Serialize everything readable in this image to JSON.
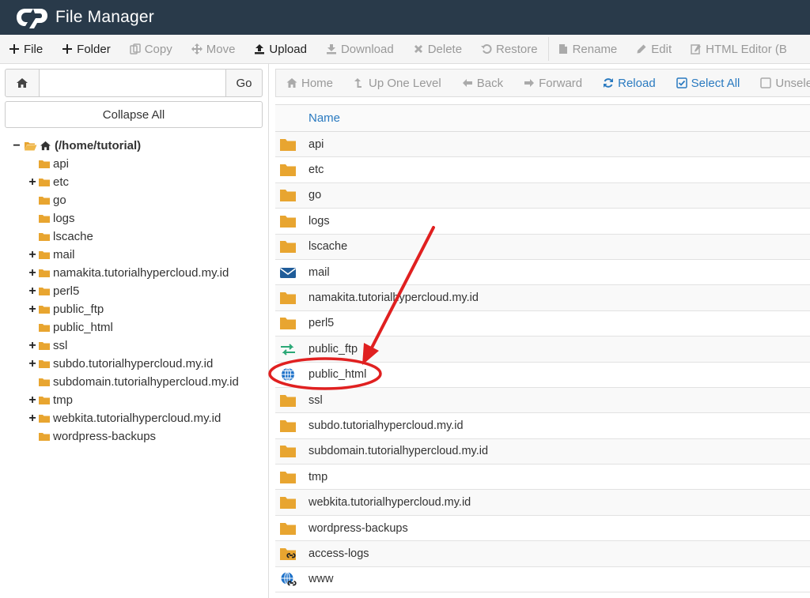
{
  "app": {
    "title": "File Manager"
  },
  "colors": {
    "header_bg": "#293a4a",
    "folder": "#e8a530",
    "link_blue": "#2a7ac0",
    "annotation_red": "#e02020",
    "mail_blue": "#1f5c99",
    "transfer_green": "#2aa876"
  },
  "toolbar": {
    "items": [
      {
        "label": "File",
        "icon": "plus-icon",
        "active": true
      },
      {
        "label": "Folder",
        "icon": "plus-icon",
        "active": true
      },
      {
        "label": "Copy",
        "icon": "copy-icon",
        "active": false
      },
      {
        "label": "Move",
        "icon": "move-icon",
        "active": false
      },
      {
        "label": "Upload",
        "icon": "upload-icon",
        "active": true
      },
      {
        "label": "Download",
        "icon": "download-icon",
        "active": false
      },
      {
        "label": "Delete",
        "icon": "delete-icon",
        "active": false
      },
      {
        "label": "Restore",
        "icon": "restore-icon",
        "active": false
      },
      {
        "label": "Rename",
        "icon": "rename-icon",
        "active": false
      },
      {
        "label": "Edit",
        "icon": "pencil-icon",
        "active": false
      },
      {
        "label": "HTML Editor (B",
        "icon": "html-editor-icon",
        "active": false
      }
    ]
  },
  "left": {
    "path_value": "",
    "go_label": "Go",
    "collapse_label": "Collapse All",
    "root_label": "(/home/tutorial)",
    "tree": [
      {
        "label": "api",
        "expandable": false
      },
      {
        "label": "etc",
        "expandable": true
      },
      {
        "label": "go",
        "expandable": false
      },
      {
        "label": "logs",
        "expandable": false
      },
      {
        "label": "lscache",
        "expandable": false
      },
      {
        "label": "mail",
        "expandable": true
      },
      {
        "label": "namakita.tutorialhypercloud.my.id",
        "expandable": true
      },
      {
        "label": "perl5",
        "expandable": true
      },
      {
        "label": "public_ftp",
        "expandable": true
      },
      {
        "label": "public_html",
        "expandable": false
      },
      {
        "label": "ssl",
        "expandable": true
      },
      {
        "label": "subdo.tutorialhypercloud.my.id",
        "expandable": true
      },
      {
        "label": "subdomain.tutorialhypercloud.my.id",
        "expandable": false
      },
      {
        "label": "tmp",
        "expandable": true
      },
      {
        "label": "webkita.tutorialhypercloud.my.id",
        "expandable": true
      },
      {
        "label": "wordpress-backups",
        "expandable": false
      }
    ]
  },
  "nav": {
    "items": [
      {
        "label": "Home",
        "icon": "home-icon",
        "blue": false
      },
      {
        "label": "Up One Level",
        "icon": "level-up-icon",
        "blue": false
      },
      {
        "label": "Back",
        "icon": "arrow-left-icon",
        "blue": false
      },
      {
        "label": "Forward",
        "icon": "arrow-right-icon",
        "blue": false
      },
      {
        "label": "Reload",
        "icon": "reload-icon",
        "blue": true
      },
      {
        "label": "Select All",
        "icon": "checkbox-checked-icon",
        "blue": true
      },
      {
        "label": "Unselec",
        "icon": "checkbox-empty-icon",
        "blue": false
      }
    ]
  },
  "table": {
    "header_name": "Name",
    "rows": [
      {
        "name": "api",
        "icon": "folder-icon"
      },
      {
        "name": "etc",
        "icon": "folder-icon"
      },
      {
        "name": "go",
        "icon": "folder-icon"
      },
      {
        "name": "logs",
        "icon": "folder-icon"
      },
      {
        "name": "lscache",
        "icon": "folder-icon"
      },
      {
        "name": "mail",
        "icon": "envelope-icon"
      },
      {
        "name": "namakita.tutorialhypercloud.my.id",
        "icon": "folder-icon"
      },
      {
        "name": "perl5",
        "icon": "folder-icon"
      },
      {
        "name": "public_ftp",
        "icon": "transfer-icon"
      },
      {
        "name": "public_html",
        "icon": "globe-icon"
      },
      {
        "name": "ssl",
        "icon": "folder-icon"
      },
      {
        "name": "subdo.tutorialhypercloud.my.id",
        "icon": "folder-icon"
      },
      {
        "name": "subdomain.tutorialhypercloud.my.id",
        "icon": "folder-icon"
      },
      {
        "name": "tmp",
        "icon": "folder-icon"
      },
      {
        "name": "webkita.tutorialhypercloud.my.id",
        "icon": "folder-icon"
      },
      {
        "name": "wordpress-backups",
        "icon": "folder-icon"
      },
      {
        "name": "access-logs",
        "icon": "folder-link-icon"
      },
      {
        "name": "www",
        "icon": "globe-link-icon"
      }
    ]
  },
  "annotation": {
    "target": "public_html"
  }
}
